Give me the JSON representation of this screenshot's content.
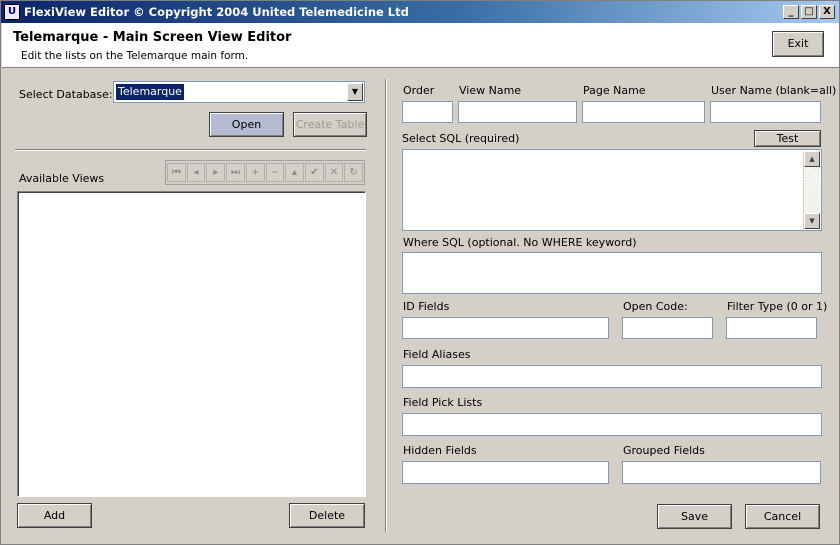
{
  "window": {
    "title": "FlexiView Editor © Copyright 2004 United Telemedicine Ltd",
    "icon_text": "U",
    "min_glyph": "_",
    "max_glyph": "□",
    "close_glyph": "X"
  },
  "header": {
    "title": "Telemarque - Main Screen View Editor",
    "subtitle": "Edit the lists on the Telemarque main form.",
    "exit_label": "Exit"
  },
  "left": {
    "select_db_label": "Select Database:",
    "db_value": "Telemarque",
    "open_label": "Open",
    "create_table_label": "Create Table",
    "available_views_label": "Available Views",
    "add_label": "Add",
    "delete_label": "Delete",
    "nav": [
      {
        "glyph": "⏮",
        "icon": "first-record-icon"
      },
      {
        "glyph": "◂",
        "icon": "prior-record-icon"
      },
      {
        "glyph": "▸",
        "icon": "next-record-icon"
      },
      {
        "glyph": "⏭",
        "icon": "last-record-icon"
      },
      {
        "glyph": "+",
        "icon": "insert-record-icon"
      },
      {
        "glyph": "−",
        "icon": "delete-record-icon"
      },
      {
        "glyph": "▴",
        "icon": "edit-record-icon"
      },
      {
        "glyph": "✔",
        "icon": "post-record-icon"
      },
      {
        "glyph": "✕",
        "icon": "cancel-edit-icon"
      },
      {
        "glyph": "↻",
        "icon": "refresh-icon"
      }
    ]
  },
  "right": {
    "order_label": "Order",
    "view_name_label": "View Name",
    "page_name_label": "Page Name",
    "user_name_label": "User Name (blank=all)",
    "select_sql_label": "Select SQL (required)",
    "test_label": "Test",
    "where_sql_label": "Where SQL (optional. No WHERE keyword)",
    "id_fields_label": "ID Fields",
    "open_code_label": "Open Code:",
    "filter_type_label": "Filter Type (0 or 1)",
    "field_aliases_label": "Field Aliases",
    "field_pick_lists_label": "Field Pick Lists",
    "hidden_fields_label": "Hidden Fields",
    "grouped_fields_label": "Grouped Fields",
    "save_label": "Save",
    "cancel_label": "Cancel",
    "scroll_up_glyph": "▲",
    "scroll_down_glyph": "▼"
  }
}
